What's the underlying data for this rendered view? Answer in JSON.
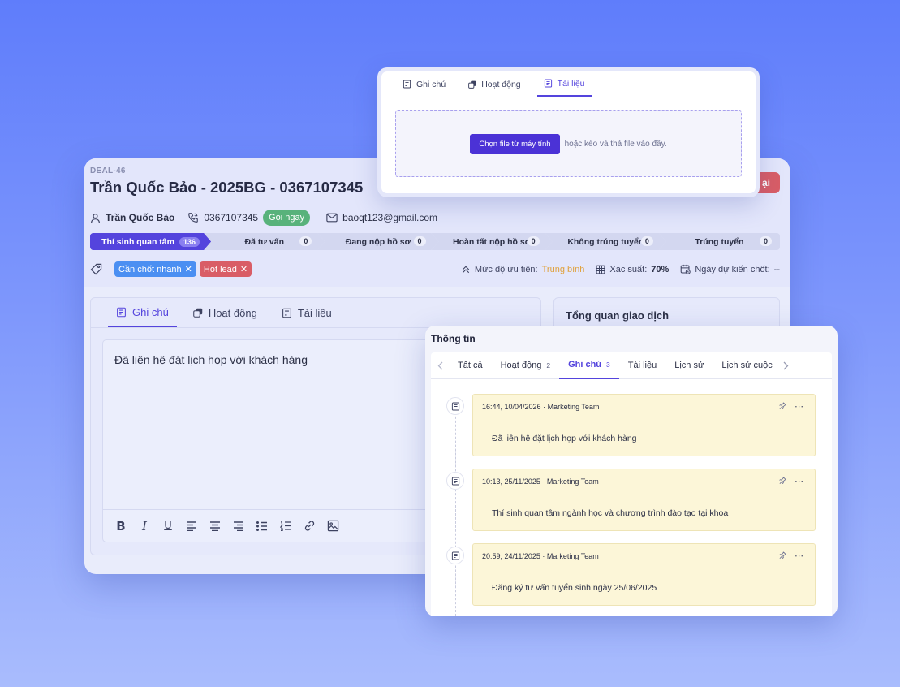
{
  "deal": {
    "code": "DEAL-46",
    "title": "Trần Quốc Bảo - 2025BG - 0367107345",
    "header_button_partial": "ại",
    "contact": {
      "name": "Trần Quốc Bảo",
      "phone": "0367107345",
      "call_label": "Gọi ngay",
      "email": "baoqt123@gmail.com"
    },
    "pipeline": [
      {
        "label": "Thí sinh quan tâm",
        "count": "136",
        "active": true
      },
      {
        "label": "Đã tư vấn",
        "count": "0"
      },
      {
        "label": "Đang nộp hồ sơ",
        "count": "0"
      },
      {
        "label": "Hoàn tất nộp hồ sơ",
        "count": "0"
      },
      {
        "label": "Không trúng tuyển",
        "count": "0"
      },
      {
        "label": "Trúng tuyển",
        "count": "0"
      }
    ],
    "tags": [
      {
        "label": "Cần chốt nhanh",
        "color": "#4b8ff2"
      },
      {
        "label": "Hot lead",
        "color": "#d95d66"
      }
    ],
    "meta": {
      "priority_label": "Mức độ ưu tiên:",
      "priority_value": "Trung bình",
      "probability_label": "Xác suất:",
      "probability_value": "70%",
      "close_date_label": "Ngày dự kiến chốt:",
      "close_date_value": "--"
    }
  },
  "note_card": {
    "tabs": [
      {
        "label": "Ghi chú",
        "active": true
      },
      {
        "label": "Hoạt động"
      },
      {
        "label": "Tài liệu"
      }
    ],
    "editor_text": "Đã liên hệ đặt lịch họp với khách hàng",
    "toolbar": [
      "bold-icon",
      "italic-icon",
      "underline-icon",
      "align-left-icon",
      "align-center-icon",
      "align-right-icon",
      "bullet-list-icon",
      "numbered-list-icon",
      "link-icon",
      "image-icon"
    ]
  },
  "overview": {
    "title": "Tổng quan giao dịch"
  },
  "upload_popup": {
    "tabs": [
      {
        "label": "Ghi chú"
      },
      {
        "label": "Hoạt động"
      },
      {
        "label": "Tài liệu",
        "active": true
      }
    ],
    "choose_button": "Chọn file từ máy tính",
    "hint": "hoặc kéo và thả file vào đây."
  },
  "info_panel": {
    "title": "Thông tin",
    "tabs": [
      {
        "label": "Tất cả"
      },
      {
        "label": "Hoạt động",
        "count": "2"
      },
      {
        "label": "Ghi chú",
        "count": "3",
        "active": true
      },
      {
        "label": "Tài liệu"
      },
      {
        "label": "Lịch sử"
      },
      {
        "label": "Lịch sử cuộc"
      }
    ],
    "notes": [
      {
        "meta": "16:44, 10/04/2026 · Marketing Team",
        "content": "Đã liên hệ đặt lịch họp với khách hàng"
      },
      {
        "meta": "10:13, 25/11/2025 · Marketing Team",
        "content": "Thí sinh quan tâm ngành học và chương trình đào tạo tại khoa"
      },
      {
        "meta": "20:59, 24/11/2025 · Marketing Team",
        "content": "Đăng ký tư vấn tuyển sinh ngày 25/06/2025"
      }
    ]
  },
  "colors": {
    "accent": "#5444dd",
    "success": "#58b27b",
    "danger": "#d95d66",
    "info": "#4b8ff2",
    "warning": "#e0a13c",
    "note_bg": "#fcf6d8"
  }
}
